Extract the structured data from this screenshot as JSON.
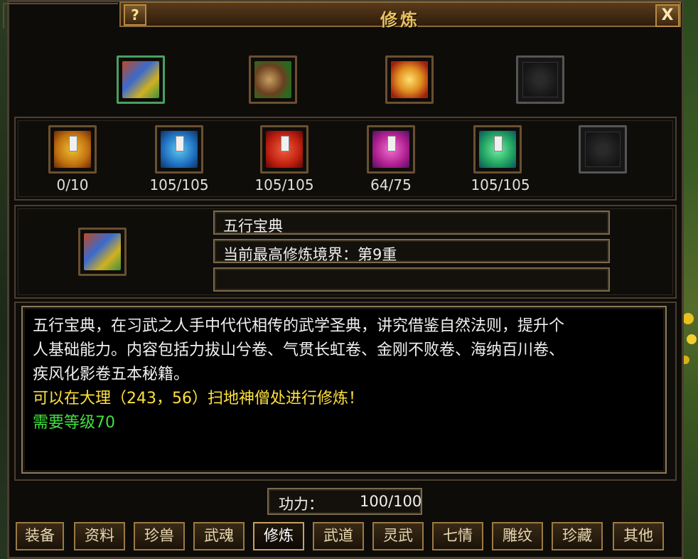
{
  "window": {
    "title": "修炼",
    "help_label": "?",
    "close_label": "X"
  },
  "top_slots": [
    {
      "icon": "multicolor-book-icon",
      "selected": true
    },
    {
      "icon": "scroll-bundle-icon",
      "selected": false
    },
    {
      "icon": "golden-scroll-icon",
      "selected": false
    },
    {
      "icon": "empty-slot-icon",
      "selected": false
    }
  ],
  "skill_books": [
    {
      "icon": "yellow-book-icon",
      "progress": "0/10"
    },
    {
      "icon": "blue-book-icon",
      "progress": "105/105"
    },
    {
      "icon": "red-book-icon",
      "progress": "105/105"
    },
    {
      "icon": "purple-book-icon",
      "progress": "64/75"
    },
    {
      "icon": "green-book-icon",
      "progress": "105/105"
    },
    {
      "icon": "empty-slot-icon",
      "progress": ""
    }
  ],
  "detail": {
    "icon": "multicolor-book-icon",
    "name": "五行宝典",
    "realm": "当前最高修炼境界：第9重",
    "extra": ""
  },
  "description": {
    "line1": "五行宝典，在习武之人手中代代相传的武学圣典，讲究借鉴自然法则，提升个",
    "line2": "人基础能力。内容包括力拔山兮卷、气贯长虹卷、金刚不败卷、海纳百川卷、",
    "line3": "疾风化影卷五本秘籍。",
    "location": "可以在大理（243，56）扫地神僧处进行修炼！",
    "requirement": "需要等级70"
  },
  "power": {
    "label": "功力：",
    "value": "100/100"
  },
  "tabs": [
    {
      "label": "装备",
      "active": false
    },
    {
      "label": "资料",
      "active": false
    },
    {
      "label": "珍兽",
      "active": false
    },
    {
      "label": "武魂",
      "active": false
    },
    {
      "label": "修炼",
      "active": true
    },
    {
      "label": "武道",
      "active": false
    },
    {
      "label": "灵武",
      "active": false
    },
    {
      "label": "七情",
      "active": false
    },
    {
      "label": "雕纹",
      "active": false
    },
    {
      "label": "珍藏",
      "active": false
    },
    {
      "label": "其他",
      "active": false
    }
  ],
  "colors": {
    "title": "#e8c060",
    "location_text": "#ffe040",
    "requirement_text": "#40e040",
    "normal_text": "#f0f0f0"
  }
}
